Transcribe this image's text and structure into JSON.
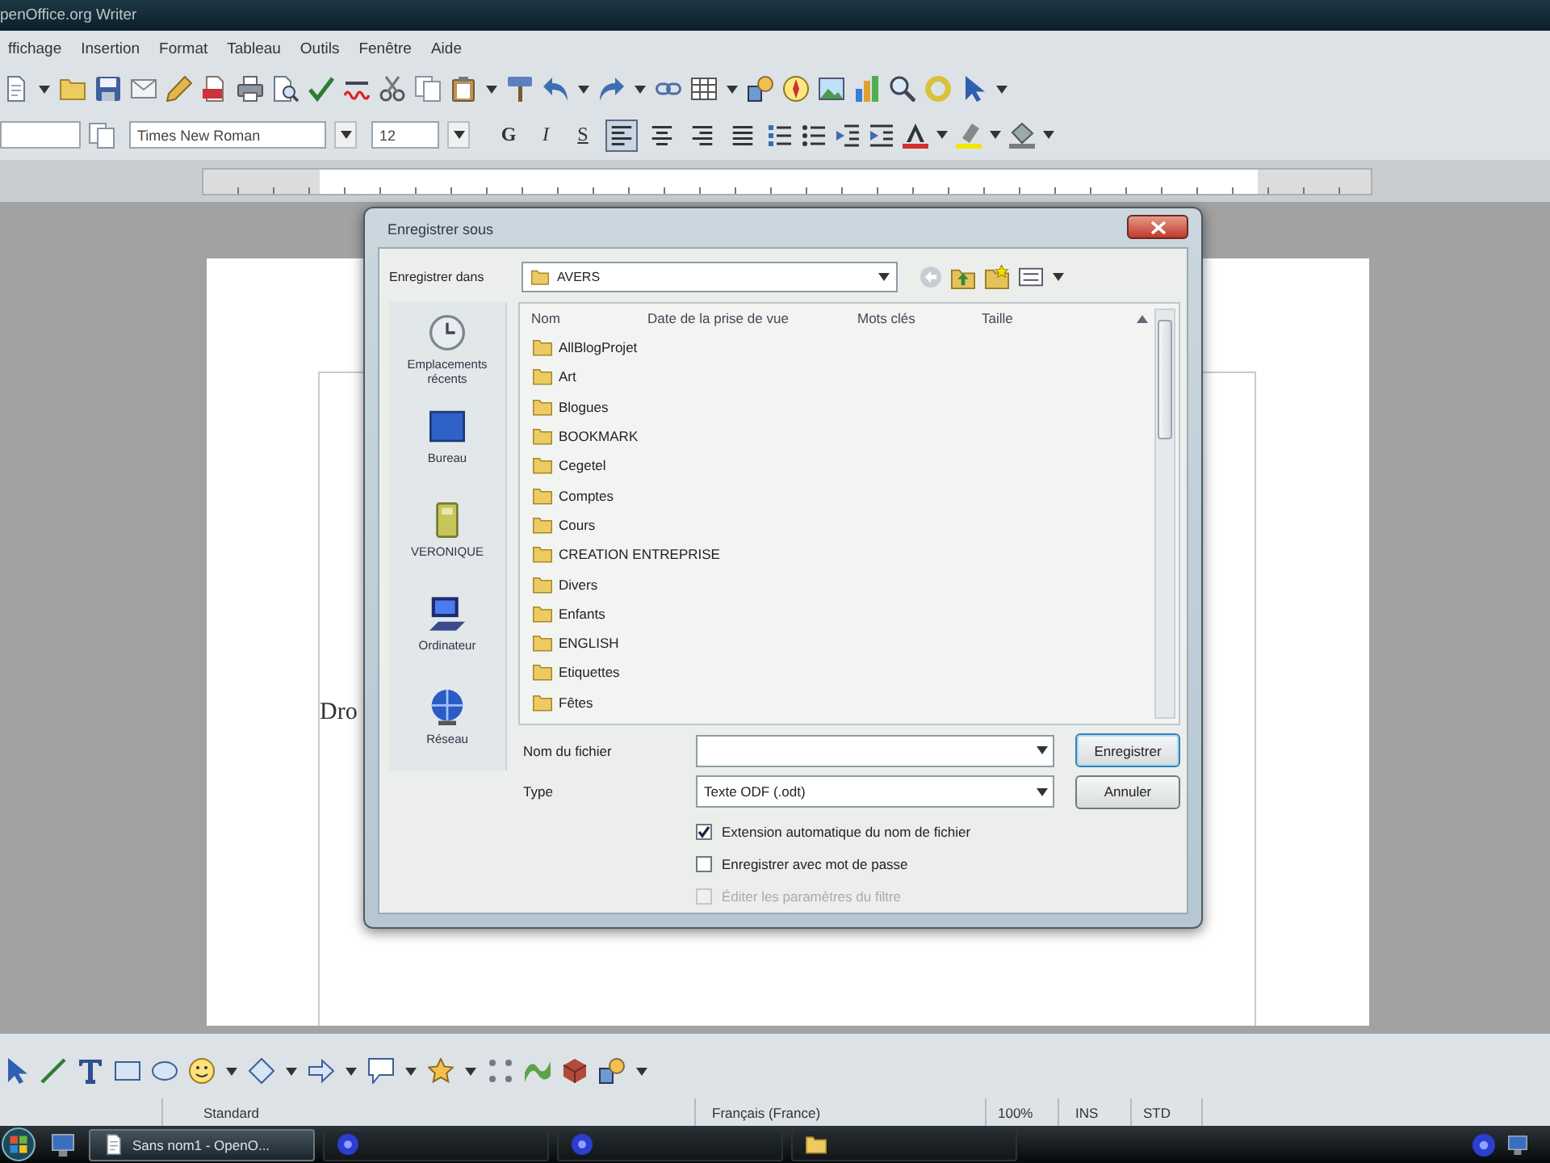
{
  "window": {
    "title": "penOffice.org Writer"
  },
  "menu": [
    "ffichage",
    "Insertion",
    "Format",
    "Tableau",
    "Outils",
    "Fenêtre",
    "Aide"
  ],
  "formatting": {
    "font_name": "Times New Roman",
    "font_size": "12",
    "style_buttons": [
      "G",
      "I",
      "S"
    ],
    "alignment": [
      {
        "kind": "left",
        "selected": true
      },
      {
        "kind": "center",
        "selected": false
      },
      {
        "kind": "right",
        "selected": false
      },
      {
        "kind": "justify",
        "selected": false
      }
    ]
  },
  "document": {
    "text": "Dro"
  },
  "dialog": {
    "title": "Enregistrer sous",
    "save_in": {
      "label": "Enregistrer dans",
      "value": "AVERS"
    },
    "places": [
      {
        "kind": "recent",
        "label": "Emplacements récents",
        "selected": false
      },
      {
        "kind": "desktop",
        "label": "Bureau",
        "selected": false
      },
      {
        "kind": "drive",
        "label": "VERONIQUE",
        "selected": false
      },
      {
        "kind": "computer",
        "label": "Ordinateur",
        "selected": false
      },
      {
        "kind": "network",
        "label": "Réseau",
        "selected": false
      }
    ],
    "columns": [
      "Nom",
      "Date de la prise de vue",
      "Mots clés",
      "Taille"
    ],
    "items": [
      {
        "label": "AllBlogProjet",
        "selected": false
      },
      {
        "label": "Art",
        "selected": false
      },
      {
        "label": "Blogues",
        "selected": false
      },
      {
        "label": "BOOKMARK",
        "selected": false
      },
      {
        "label": "Cegetel",
        "selected": false
      },
      {
        "label": "Comptes",
        "selected": false
      },
      {
        "label": "Cours",
        "selected": false
      },
      {
        "label": "CREATION ENTREPRISE",
        "selected": false
      },
      {
        "label": "Divers",
        "selected": false
      },
      {
        "label": "Enfants",
        "selected": false
      },
      {
        "label": "ENGLISH",
        "selected": false
      },
      {
        "label": "Etiquettes",
        "selected": false
      },
      {
        "label": "Fêtes",
        "selected": false
      }
    ],
    "file_name": {
      "label": "Nom du fichier"
    },
    "file_type": {
      "label": "Type",
      "value": "Texte ODF (.odt)"
    },
    "buttons": [
      "Enregistrer",
      "Annuler"
    ],
    "options": [
      {
        "label": "Extension automatique du nom de fichier",
        "checked": true,
        "disabled": false
      },
      {
        "label": "Enregistrer avec mot de passe",
        "checked": false,
        "disabled": false
      },
      {
        "label": "Éditer les paramètres du filtre",
        "checked": false,
        "disabled": true
      }
    ]
  },
  "status_bar": {
    "page_style": "Standard",
    "language": "Français (France)",
    "zoom": "100%",
    "insert_mode": "INS",
    "selection_mode": "STD"
  },
  "taskbar": {
    "windows": [
      {
        "kind": "document",
        "label": "Sans nom1 - OpenO...",
        "selected": true
      },
      {
        "kind": "disc",
        "selected": false
      },
      {
        "kind": "disc",
        "selected": false
      },
      {
        "kind": "folder",
        "selected": false
      }
    ]
  }
}
